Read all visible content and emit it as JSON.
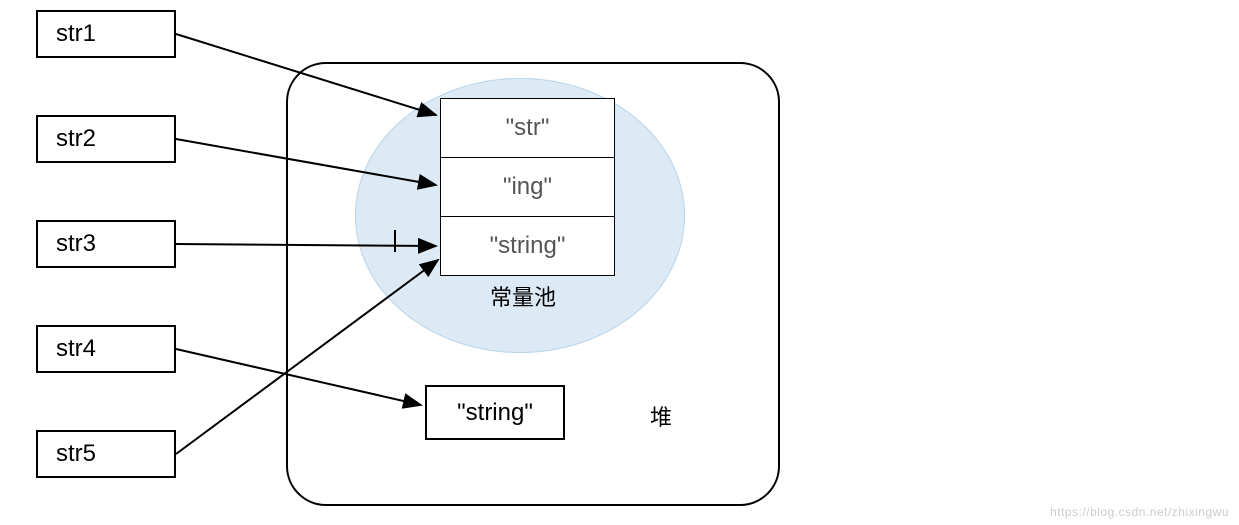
{
  "vars": {
    "v1": "str1",
    "v2": "str2",
    "v3": "str3",
    "v4": "str4",
    "v5": "str5"
  },
  "pool": {
    "cell1": "\"str\"",
    "cell2": "\"ing\"",
    "cell3": "\"string\"",
    "label": "常量池"
  },
  "heap": {
    "string_box": "\"string\"",
    "label": "堆"
  },
  "watermark": "https://blog.csdn.net/zhixingwu"
}
